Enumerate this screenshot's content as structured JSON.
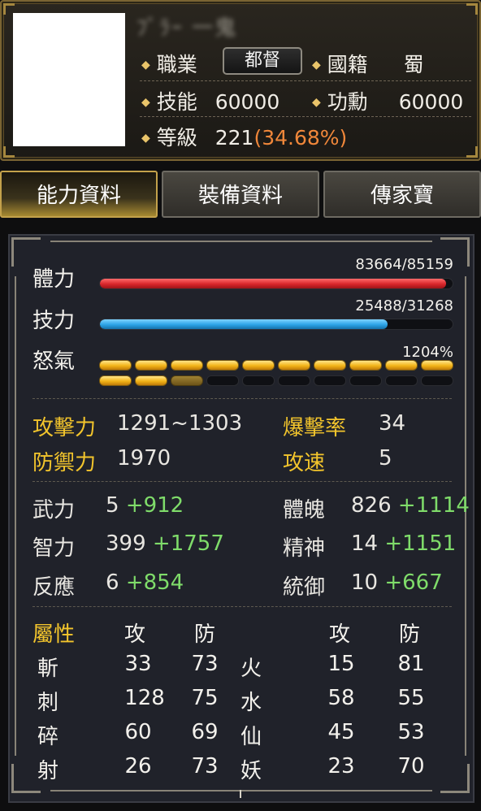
{
  "header": {
    "name_blurred": "ﾌﾞﾗｰ 一鬼",
    "job_label": "職業",
    "job_value": "都督",
    "nation_label": "國籍",
    "nation_value": "蜀",
    "skill_label": "技能",
    "skill_value": "60000",
    "merit_label": "功勳",
    "merit_value": "60000",
    "level_label": "等級",
    "level_value": "221",
    "level_percent": "(34.68%)"
  },
  "tabs": [
    {
      "label": "能力資料",
      "active": true
    },
    {
      "label": "裝備資料",
      "active": false
    },
    {
      "label": "傳家寶",
      "active": false
    }
  ],
  "bars": {
    "hp": {
      "label": "體力",
      "text": "83664/85159",
      "current": 83664,
      "max": 85159
    },
    "mp": {
      "label": "技力",
      "text": "25488/31268",
      "current": 25488,
      "max": 31268
    },
    "rage": {
      "label": "怒氣",
      "text": "1204%",
      "full_segments": 12,
      "partial_segments": 1,
      "total_segments": 20
    }
  },
  "combat": {
    "attack_label": "攻擊力",
    "attack_value": "1291~1303",
    "crit_label": "爆擊率",
    "crit_value": "34",
    "defense_label": "防禦力",
    "defense_value": "1970",
    "speed_label": "攻速",
    "speed_value": "5"
  },
  "attributes": [
    {
      "label": "武力",
      "base": "5",
      "bonus": "+912"
    },
    {
      "label": "體魄",
      "base": "826",
      "bonus": "+1114"
    },
    {
      "label": "智力",
      "base": "399",
      "bonus": "+1757"
    },
    {
      "label": "精神",
      "base": "14",
      "bonus": "+1151"
    },
    {
      "label": "反應",
      "base": "6",
      "bonus": "+854"
    },
    {
      "label": "統御",
      "base": "10",
      "bonus": "+667"
    }
  ],
  "resist": {
    "header_label": "屬性",
    "atk_label": "攻",
    "def_label": "防",
    "atk_label2": "攻",
    "def_label2": "防",
    "rows": [
      {
        "type": "斬",
        "atk": "33",
        "def": "73",
        "type2": "火",
        "atk2": "15",
        "def2": "81"
      },
      {
        "type": "刺",
        "atk": "128",
        "def": "75",
        "type2": "水",
        "atk2": "58",
        "def2": "55"
      },
      {
        "type": "碎",
        "atk": "60",
        "def": "69",
        "type2": "仙",
        "atk2": "45",
        "def2": "53"
      },
      {
        "type": "射",
        "atk": "26",
        "def": "73",
        "type2": "妖",
        "atk2": "23",
        "def2": "70"
      }
    ]
  },
  "colors": {
    "gold": "#f3c52c",
    "green": "#7fdc6a",
    "orange": "#f0873a",
    "hp": "#d8262b",
    "mp": "#2ca3e6",
    "rage": "#f2b418"
  }
}
